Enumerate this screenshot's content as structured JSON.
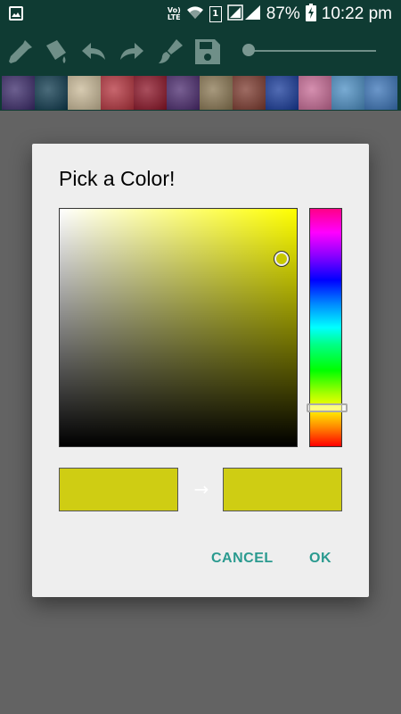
{
  "status_bar": {
    "volte_top": "Vo)",
    "volte_bottom": "LTE",
    "sim_slot": "1",
    "battery_percent": "87%",
    "time": "10:22 pm",
    "icons": [
      "gallery-icon",
      "volte-icon",
      "wifi-icon",
      "sim-icon",
      "signal-icon",
      "battery-charging-icon"
    ]
  },
  "toolbar": {
    "icons": [
      "eyedropper-icon",
      "paint-bucket-icon",
      "undo-icon",
      "redo-icon",
      "brush-icon",
      "save-icon"
    ],
    "brush_size_slider": {
      "value": 0.0
    }
  },
  "texture_strip": {
    "thumbnails": [
      {
        "name": "mandala",
        "color": "#3b2a6a"
      },
      {
        "name": "night-light",
        "color": "#0e3a4e"
      },
      {
        "name": "paper",
        "color": "#c9b997"
      },
      {
        "name": "plaid",
        "color": "#b5333d"
      },
      {
        "name": "red-fabric",
        "color": "#8c1326"
      },
      {
        "name": "pixels",
        "color": "#4b2a6e"
      },
      {
        "name": "mosaic",
        "color": "#8a7752"
      },
      {
        "name": "colorful",
        "color": "#7d3a2e"
      },
      {
        "name": "blue-texture",
        "color": "#173a9a"
      },
      {
        "name": "flowers",
        "color": "#c76a95"
      },
      {
        "name": "blue-sky",
        "color": "#4c8fc4"
      },
      {
        "name": "moon-sea",
        "color": "#3a74b8"
      }
    ]
  },
  "dialog": {
    "title": "Pick a Color!",
    "hue_color": "#ffff00",
    "old_color": "#cfcd13",
    "new_color": "#cfcd13",
    "arrow": "→",
    "cancel_label": "CANCEL",
    "ok_label": "OK",
    "accent_color": "#2a9a8f"
  }
}
